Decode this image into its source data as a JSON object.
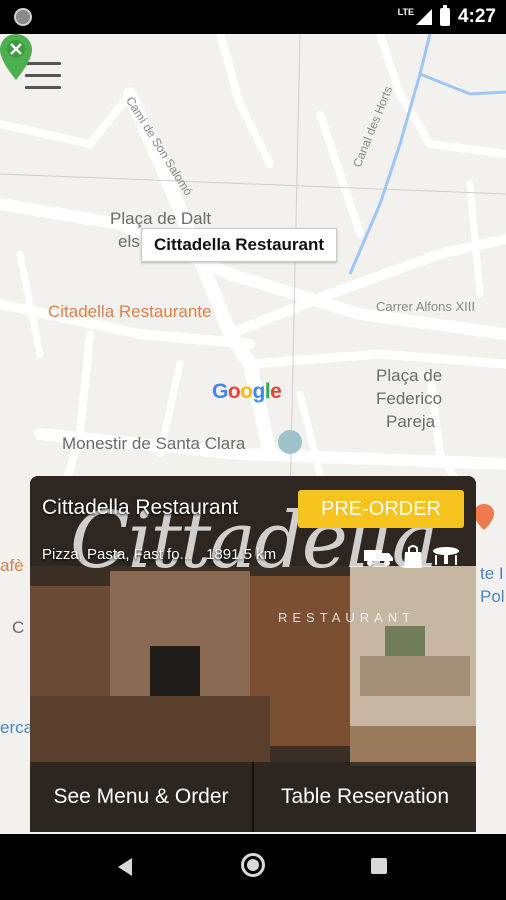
{
  "status_bar": {
    "network": "LTE",
    "time": "4:27"
  },
  "map": {
    "labels": {
      "street_camí": "Camí de Son Salomó",
      "street_canal": "Canal des Horts",
      "plaza_dalt_1": "Plaça de Dalt",
      "plaza_dalt_2": "els",
      "restaurant_label": "Citadella Restaurante",
      "carrer_alfons": "Carrer Alfons XIII",
      "plaza_federico_1": "Plaça de",
      "plaza_federico_2": "Federico",
      "plaza_federico_3": "Pareja",
      "monestir": "Monestir de Santa Clara",
      "left_cafe": "afè",
      "left_c": "C",
      "left_erca": "erca",
      "right_te": "te I",
      "right_pol": "Pol"
    },
    "callout": "Cittadella Restaurant",
    "google": {
      "G": "G",
      "o1": "o",
      "o2": "o",
      "g": "g",
      "l": "l",
      "e": "e"
    }
  },
  "card": {
    "title": "Cittadella Restaurant",
    "preorder_label": "PRE-ORDER",
    "cuisine": "Pizza, Pasta, Fast fo...",
    "distance": "1891.5 km",
    "brand_name": "Cittadella",
    "brand_sub": "RESTAURANT",
    "see_menu_label": "See Menu & Order",
    "table_reservation_label": "Table Reservation"
  }
}
